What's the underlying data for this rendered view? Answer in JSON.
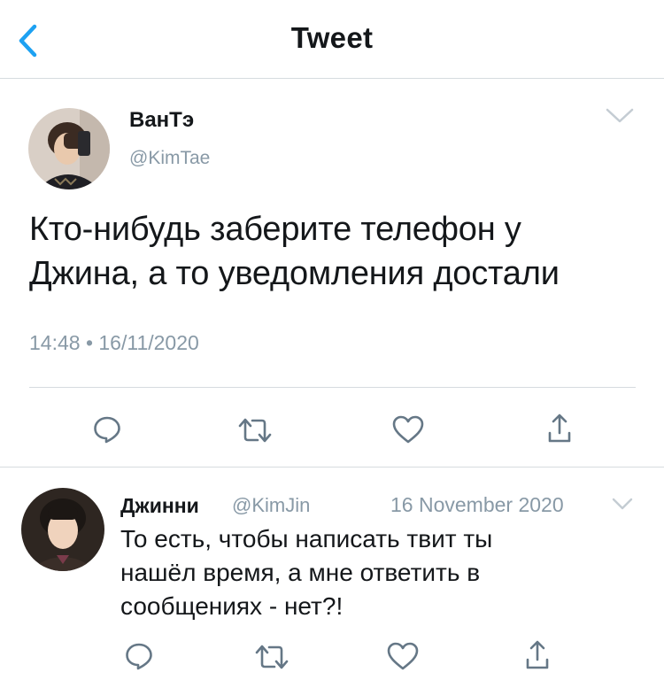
{
  "header": {
    "title": "Tweet",
    "back_icon": "chevron-left-icon",
    "accent": "#1da1f2"
  },
  "tweet": {
    "author_name": "ВанТэ",
    "author_handle": "@KimTae",
    "text_lines": [
      "Кто-нибудь заберите телефон у",
      "Джина, а то уведомления достали"
    ],
    "timestamp": "14:48 • 16/11/2020",
    "actions": [
      "reply-icon",
      "retweet-icon",
      "like-icon",
      "share-icon"
    ]
  },
  "reply": {
    "author_name": "Джинни",
    "author_handle": "@KimJin",
    "date": "16 November 2020",
    "text_lines": [
      "То есть, чтобы написать твит ты",
      "нашёл время, а мне ответить в",
      "сообщениях - нет?!"
    ],
    "actions": [
      "reply-icon",
      "retweet-icon",
      "like-icon",
      "share-icon"
    ]
  },
  "colors": {
    "muted": "#8899a6",
    "icon_gray": "#657786",
    "divider": "#d6dbdf",
    "text": "#14171a"
  }
}
